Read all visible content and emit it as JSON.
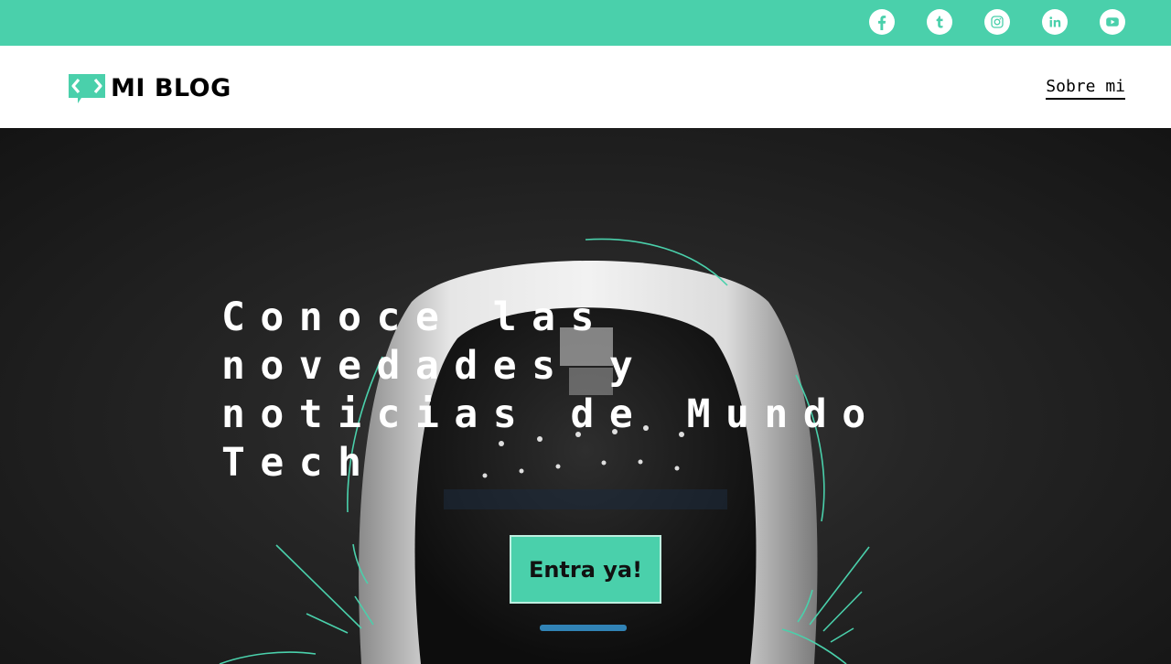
{
  "topbar": {
    "color": "#4ad0ab",
    "social": [
      {
        "icon": "facebook-icon"
      },
      {
        "icon": "tumblr-icon"
      },
      {
        "icon": "instagram-icon"
      },
      {
        "icon": "linkedin-icon"
      },
      {
        "icon": "youtube-icon"
      }
    ]
  },
  "header": {
    "logo_text": "MI BLOG",
    "nav": {
      "about_label": "Sobre mi"
    }
  },
  "hero": {
    "title": "Conoce las novedades y noticias de Mundo Tech",
    "cta_label": "Entra ya!",
    "background_image": "robot-astronaut-helmet"
  },
  "colors": {
    "accent": "#4ad0ab",
    "text_dark": "#000000",
    "text_light": "#ffffff"
  }
}
